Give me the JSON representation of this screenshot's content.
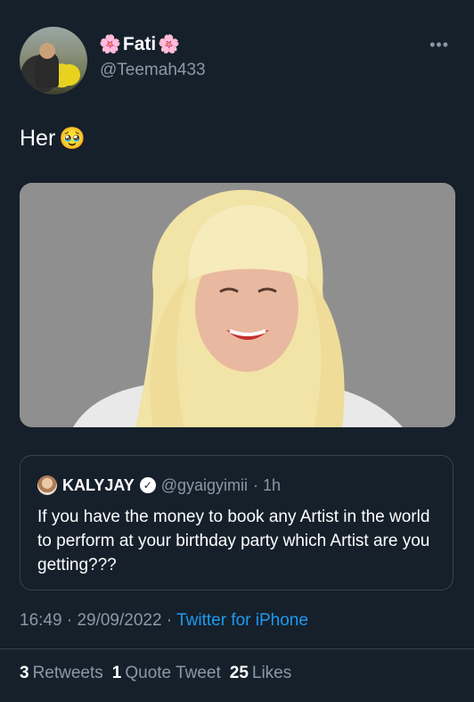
{
  "author": {
    "display_name": "Fati",
    "name_emoji": "🌸",
    "handle": "@Teemah433",
    "avatar_icon": "avatar-photo"
  },
  "more_label": "•••",
  "tweet": {
    "text": "Her",
    "emoji": "🥹"
  },
  "media": {
    "description_icon": "photo"
  },
  "quoted_tweet": {
    "name": "KALYJAY",
    "handle": "@gyaigyimii",
    "time": "· 1h",
    "text": "If you have the money to book any Artist in the world to perform at your birthday party which Artist are you getting???"
  },
  "meta": {
    "time": "16:49",
    "sep1": " · ",
    "date": "29/09/2022",
    "sep2": " · ",
    "app": "Twitter for iPhone"
  },
  "stats": {
    "retweets_count": "3",
    "retweets_label": "Retweets",
    "quotes_count": "1",
    "quotes_label": "Quote Tweet",
    "likes_count": "25",
    "likes_label": "Likes"
  },
  "colors": {
    "background": "#15202b",
    "secondary_text": "#8b98a5",
    "link": "#1d9bf0",
    "border": "#38444d"
  }
}
